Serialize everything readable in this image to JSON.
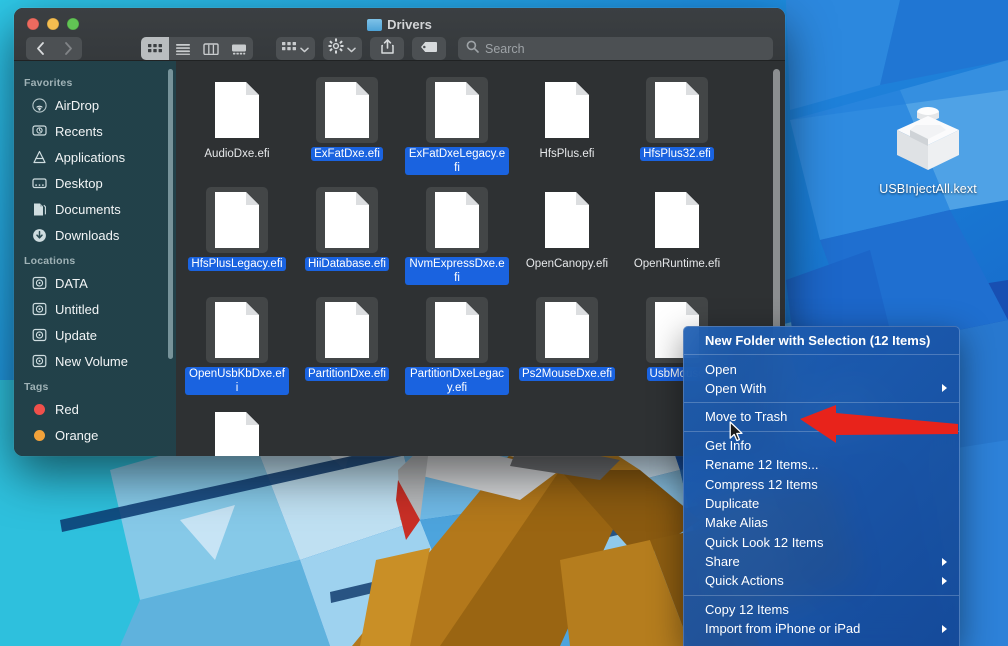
{
  "window": {
    "title": "Drivers",
    "folder_icon": "folder-icon",
    "traffic_lights": [
      {
        "name": "close",
        "color": "#ec6a5f"
      },
      {
        "name": "minimize",
        "color": "#f4bd50"
      },
      {
        "name": "zoom",
        "color": "#61c454"
      }
    ]
  },
  "toolbar": {
    "back_icon": "chevron-left-icon",
    "forward_icon": "chevron-right-icon",
    "view_icon_grid": "grid-view-icon",
    "view_list": "list-view-icon",
    "view_column": "column-view-icon",
    "view_gallery": "gallery-view-icon",
    "group_icon": "group-by-icon",
    "group_chevron": "chevron-down-icon",
    "action_icon": "gear-icon",
    "action_chevron": "chevron-down-icon",
    "share_icon": "share-icon",
    "tag_icon": "tag-icon",
    "search_icon": "search-icon",
    "search_placeholder": "Search",
    "search_value": ""
  },
  "sidebar": {
    "sections": [
      {
        "header": "Favorites",
        "items": [
          {
            "label": "AirDrop",
            "icon": "airdrop-icon"
          },
          {
            "label": "Recents",
            "icon": "recents-clock-icon"
          },
          {
            "label": "Applications",
            "icon": "applications-icon"
          },
          {
            "label": "Desktop",
            "icon": "desktop-icon"
          },
          {
            "label": "Documents",
            "icon": "documents-icon"
          },
          {
            "label": "Downloads",
            "icon": "downloads-icon"
          }
        ]
      },
      {
        "header": "Locations",
        "items": [
          {
            "label": "DATA",
            "icon": "disk-icon"
          },
          {
            "label": "Untitled",
            "icon": "disk-icon"
          },
          {
            "label": "Update",
            "icon": "disk-icon"
          },
          {
            "label": "New Volume",
            "icon": "disk-icon"
          }
        ]
      },
      {
        "header": "Tags",
        "items": [
          {
            "label": "Red",
            "icon": "tag-dot-icon",
            "color": "#f0504b"
          },
          {
            "label": "Orange",
            "icon": "tag-dot-icon",
            "color": "#f2a23a"
          }
        ]
      }
    ]
  },
  "files": [
    {
      "name": "AudioDxe.efi",
      "selected": false
    },
    {
      "name": "ExFatDxe.efi",
      "selected": true
    },
    {
      "name": "ExFatDxeLegacy.efi",
      "selected": true
    },
    {
      "name": "HfsPlus.efi",
      "selected": false
    },
    {
      "name": "HfsPlus32.efi",
      "selected": true
    },
    {
      "name": "HfsPlusLegacy.efi",
      "selected": true
    },
    {
      "name": "HiiDatabase.efi",
      "selected": true
    },
    {
      "name": "NvmExpressDxe.efi",
      "selected": true
    },
    {
      "name": "OpenCanopy.efi",
      "selected": false
    },
    {
      "name": "OpenRuntime.efi",
      "selected": false
    },
    {
      "name": "OpenUsbKbDxe.efi",
      "selected": true
    },
    {
      "name": "PartitionDxe.efi",
      "selected": true
    },
    {
      "name": "PartitionDxeLegacy.efi",
      "selected": true
    },
    {
      "name": "Ps2MouseDxe.efi",
      "selected": true
    },
    {
      "name": "UsbMouse",
      "selected": true
    },
    {
      "name": "",
      "selected": false
    }
  ],
  "context_menu": {
    "groups": [
      [
        {
          "label": "New Folder with Selection (12 Items)",
          "bold": true,
          "submenu": false
        }
      ],
      [
        {
          "label": "Open",
          "bold": false,
          "submenu": false
        },
        {
          "label": "Open With",
          "bold": false,
          "submenu": true
        }
      ],
      [
        {
          "label": "Move to Trash",
          "bold": false,
          "submenu": false,
          "highlighted": true
        }
      ],
      [
        {
          "label": "Get Info",
          "bold": false,
          "submenu": false
        },
        {
          "label": "Rename 12 Items...",
          "bold": false,
          "submenu": false
        },
        {
          "label": "Compress 12 Items",
          "bold": false,
          "submenu": false
        },
        {
          "label": "Duplicate",
          "bold": false,
          "submenu": false
        },
        {
          "label": "Make Alias",
          "bold": false,
          "submenu": false
        },
        {
          "label": "Quick Look 12 Items",
          "bold": false,
          "submenu": false
        },
        {
          "label": "Share",
          "bold": false,
          "submenu": true
        },
        {
          "label": "Quick Actions",
          "bold": false,
          "submenu": true
        }
      ],
      [
        {
          "label": "Copy 12 Items",
          "bold": false,
          "submenu": false
        },
        {
          "label": "Import from iPhone or iPad",
          "bold": false,
          "submenu": true
        }
      ]
    ]
  },
  "desktop": {
    "icon": {
      "label": "USBInjectAll.kext",
      "glyph": "kext-block-icon"
    }
  },
  "annotation": {
    "arrow_color": "#e8231b",
    "points_to": "Move to Trash"
  },
  "cursor": {
    "type": "arrow-pointer"
  },
  "colors": {
    "selection_blue": "#1a63e0",
    "menu_blue": "#1e5fb4",
    "sidebar_teal": "#284850",
    "pane_dark": "#2e3133"
  }
}
